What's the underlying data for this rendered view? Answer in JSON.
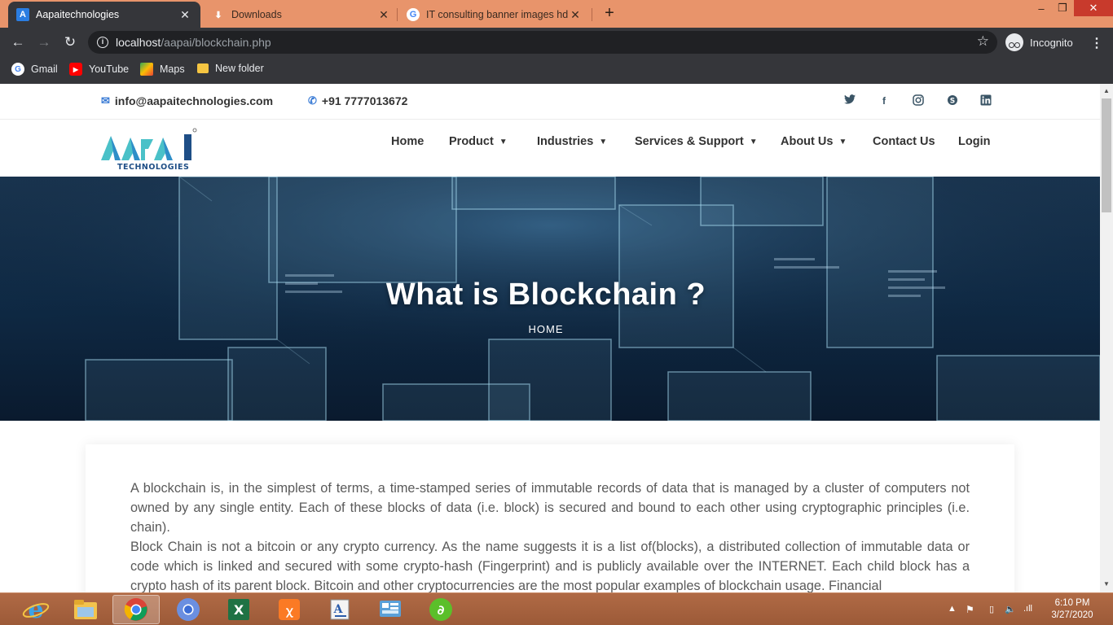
{
  "browser": {
    "tabs": [
      {
        "title": "Aapaitechnologies",
        "favicon": "A",
        "active": true
      },
      {
        "title": "Downloads",
        "favicon": "download-icon",
        "active": false
      },
      {
        "title": "IT consulting banner images hd -",
        "favicon": "G",
        "active": false
      }
    ],
    "url_host": "localhost",
    "url_path": "/aapai/blockchain.php",
    "incognito_label": "Incognito",
    "bookmarks": [
      {
        "label": "Gmail",
        "icon": "G"
      },
      {
        "label": "YouTube",
        "icon": "youtube-icon"
      },
      {
        "label": "Maps",
        "icon": "maps-icon"
      },
      {
        "label": "New folder",
        "icon": "folder-icon"
      }
    ]
  },
  "site": {
    "email": "info@aapaitechnologies.com",
    "phone": "+91 7777013672",
    "social": [
      "twitter-icon",
      "facebook-icon",
      "instagram-icon",
      "skype-icon",
      "linkedin-icon"
    ],
    "logo_text": "TECHNOLOGIES",
    "nav": [
      {
        "label": "Home",
        "dropdown": false
      },
      {
        "label": "Product",
        "dropdown": true
      },
      {
        "label": "Industries",
        "dropdown": true
      },
      {
        "label": "Services & Support",
        "dropdown": true
      },
      {
        "label": "About Us",
        "dropdown": true
      },
      {
        "label": "Contact Us",
        "dropdown": false
      },
      {
        "label": "Login",
        "dropdown": false
      }
    ],
    "hero": {
      "title": "What is Blockchain ?",
      "breadcrumb": "HOME"
    },
    "paragraphs": [
      "A blockchain is, in the simplest of terms, a time-stamped series of immutable records of data that is managed by a cluster of computers not owned by any single entity. Each of these blocks of data (i.e. block) is secured and bound to each other using cryptographic principles (i.e. chain).",
      "Block Chain is not a bitcoin or any crypto currency. As the name suggests it is a list of(blocks), a distributed collection of immutable data or code which is linked and secured with some crypto-hash (Fingerprint) and is publicly available over the INTERNET. Each child block has a crypto hash of its parent block. Bitcoin and other cryptocurrencies are the most popular examples of blockchain usage. Financial"
    ]
  },
  "taskbar": {
    "time": "6:10 PM",
    "date": "3/27/2020",
    "apps": [
      "internet-explorer-icon",
      "file-explorer-icon",
      "chrome-icon",
      "chrome-canary-icon",
      "excel-icon",
      "xampp-icon",
      "word-pad-icon",
      "control-panel-icon",
      "app-green-icon"
    ]
  },
  "colors": {
    "tabstrip": "#e8946b",
    "toolbar": "#35363a",
    "accent_blue": "#3a7bd5",
    "logo_teal": "#4ac1c8",
    "logo_navy": "#1e4e86",
    "taskbar": "#a5613e"
  }
}
